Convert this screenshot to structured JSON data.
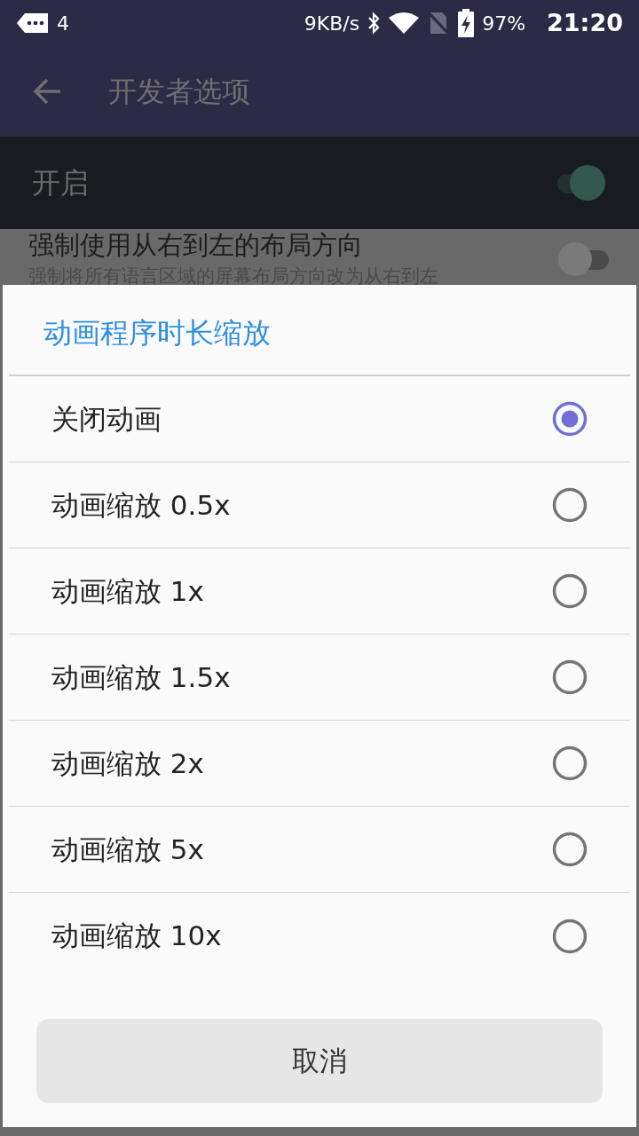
{
  "status_bar": {
    "notification_count": "4",
    "net_speed": "9KB/s",
    "battery": "97%",
    "time": "21:20"
  },
  "toolbar": {
    "title": "开发者选项"
  },
  "master_switch": {
    "label": "开启",
    "on": true
  },
  "settings": [
    {
      "title": "强制使用从右到左的布局方向",
      "subtitle": "强制将所有语言区域的屏幕布局方向改为从右到左",
      "on": false
    }
  ],
  "dialog": {
    "title": "动画程序时长缩放",
    "options": [
      {
        "label": "关闭动画",
        "selected": true
      },
      {
        "label": "动画缩放 0.5x",
        "selected": false
      },
      {
        "label": "动画缩放 1x",
        "selected": false
      },
      {
        "label": "动画缩放 1.5x",
        "selected": false
      },
      {
        "label": "动画缩放 2x",
        "selected": false
      },
      {
        "label": "动画缩放 5x",
        "selected": false
      },
      {
        "label": "动画缩放 10x",
        "selected": false
      }
    ],
    "cancel": "取消"
  }
}
